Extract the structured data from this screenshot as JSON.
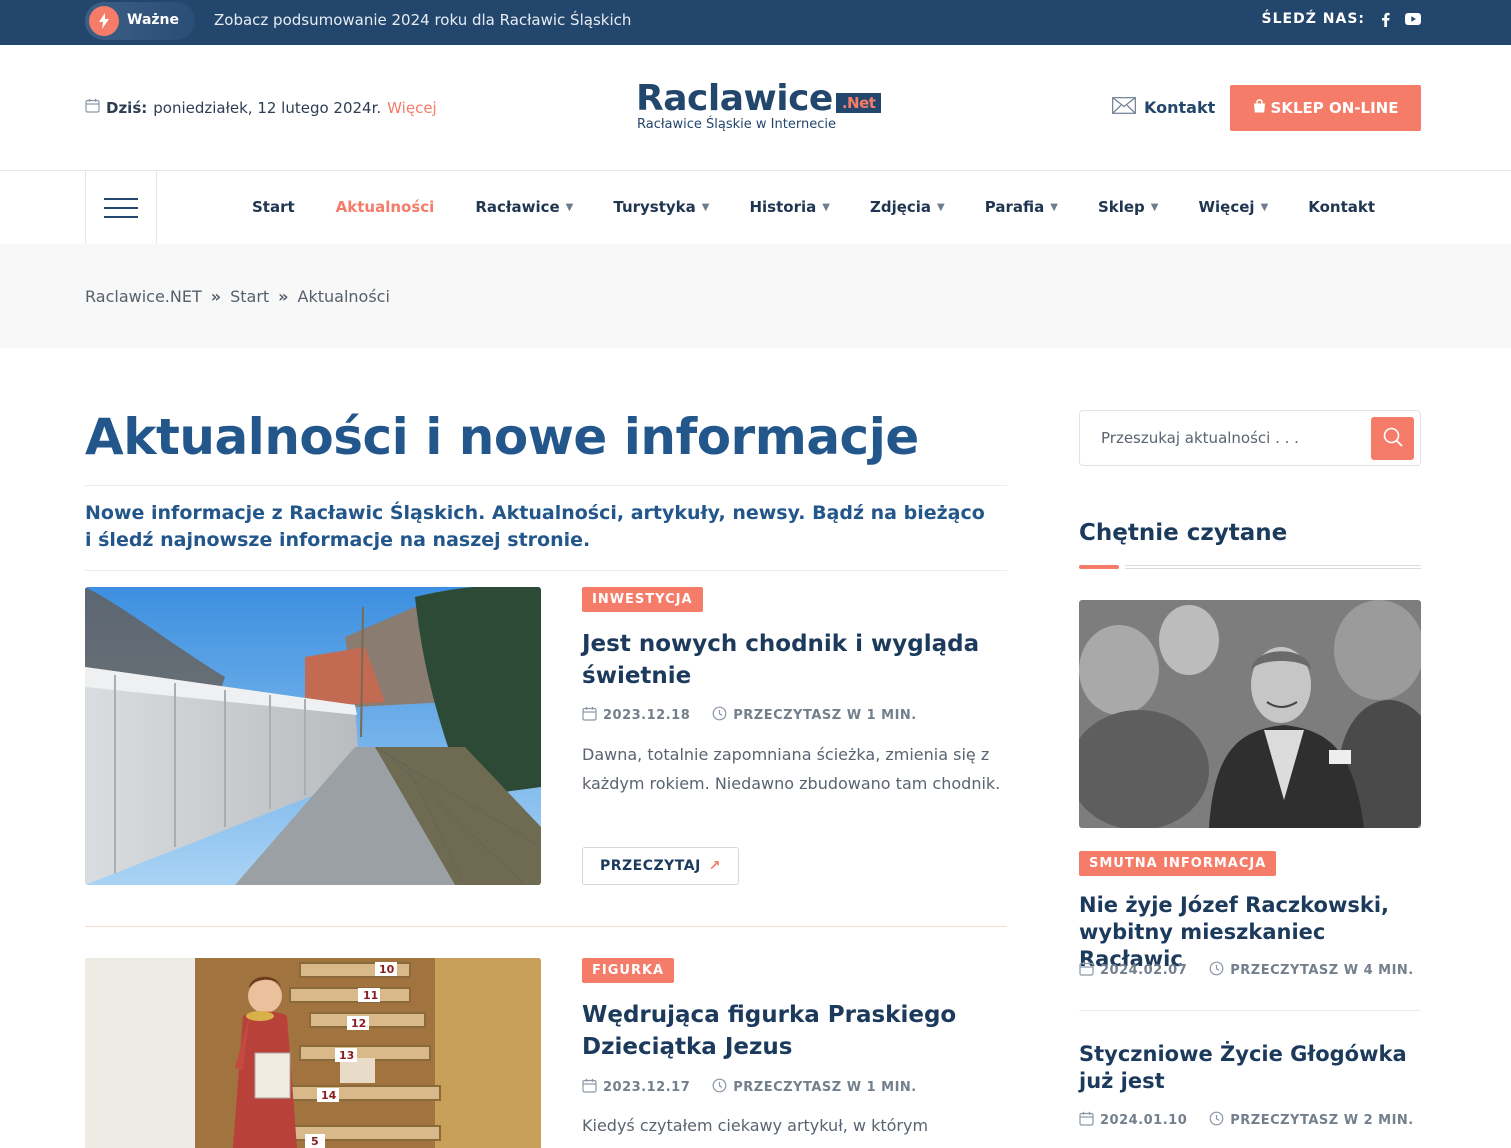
{
  "topbar": {
    "badge": "Ważne",
    "headline": "Zobacz podsumowanie 2024 roku dla Racławic Śląskich",
    "follow_label": "ŚLEDŹ NAS:",
    "social": [
      "facebook-icon",
      "youtube-icon"
    ]
  },
  "header": {
    "date_label": "Dziś:",
    "date_value": "poniedziałek, 12 lutego 2024r.",
    "date_more": "Więcej",
    "logo_main": "Raclawice",
    "logo_net": ".Net",
    "logo_tagline": "Racławice Śląskie w Internecie",
    "contact": "Kontakt",
    "shop_button": "SKLEP ON-LINE"
  },
  "nav": {
    "items": [
      {
        "label": "Start",
        "dropdown": false,
        "active": false
      },
      {
        "label": "Aktualności",
        "dropdown": false,
        "active": true
      },
      {
        "label": "Racławice",
        "dropdown": true,
        "active": false
      },
      {
        "label": "Turystyka",
        "dropdown": true,
        "active": false
      },
      {
        "label": "Historia",
        "dropdown": true,
        "active": false
      },
      {
        "label": "Zdjęcia",
        "dropdown": true,
        "active": false
      },
      {
        "label": "Parafia",
        "dropdown": true,
        "active": false
      },
      {
        "label": "Sklep",
        "dropdown": true,
        "active": false
      },
      {
        "label": "Więcej",
        "dropdown": true,
        "active": false
      },
      {
        "label": "Kontakt",
        "dropdown": false,
        "active": false
      }
    ]
  },
  "breadcrumb": [
    "Raclawice.NET",
    "Start",
    "Aktualności"
  ],
  "main": {
    "title": "Aktualności i nowe informacje",
    "intro": "Nowe informacje z Racławic Śląskich. Aktualności, artykuły, newsy. Bądź na bieżąco i śledź najnowsze informacje na naszej stronie.",
    "articles": [
      {
        "tag": "INWESTYCJA",
        "title": "Jest nowych chodnik i wygląda świetnie",
        "date": "2023.12.18",
        "read_time": "PRZECZYTASZ W 1 MIN.",
        "excerpt": "Dawna, totalnie zapomniana ścieżka, zmienia się z każdym rokiem. Niedawno zbudowano tam chodnik.",
        "button": "PRZECZYTAJ"
      },
      {
        "tag": "FIGURKA",
        "title": "Wędrująca figurka Praskiego Dzieciątka Jezus",
        "date": "2023.12.17",
        "read_time": "PRZECZYTASZ W 1 MIN.",
        "excerpt": "Kiedyś czytałem ciekawy artykuł, w którym",
        "image_numbers": [
          "10",
          "11",
          "12",
          "13",
          "14",
          "5"
        ]
      }
    ]
  },
  "sidebar": {
    "search_placeholder": "Przeszukaj aktualności . . .",
    "heading": "Chętnie czytane",
    "posts": [
      {
        "tag": "SMUTNA INFORMACJA",
        "title": "Nie żyje Józef Raczkowski, wybitny mieszkaniec Racławic",
        "date": "2024.02.07",
        "read_time": "PRZECZYTASZ W 4 MIN."
      },
      {
        "title": "Styczniowe Życie Głogówka już jest",
        "date": "2024.01.10",
        "read_time": "PRZECZYTASZ W 2 MIN."
      }
    ]
  },
  "colors": {
    "primary": "#23466d",
    "accent": "#f47c69",
    "title": "#23578c"
  }
}
